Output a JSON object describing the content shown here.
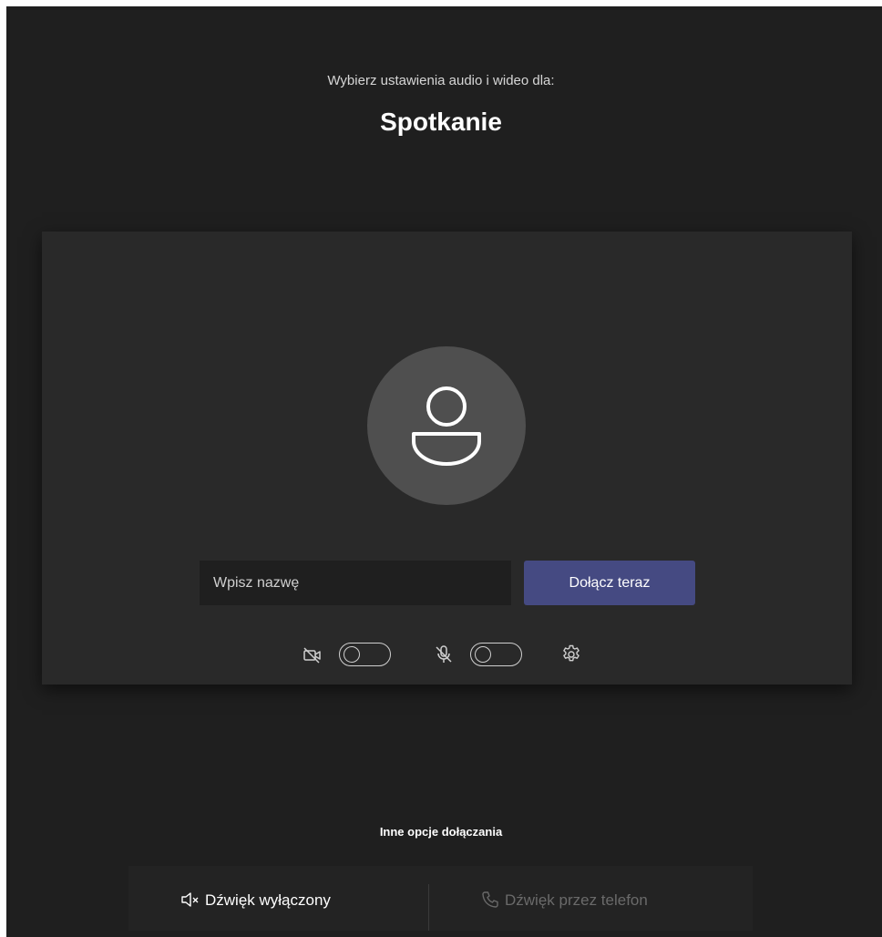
{
  "header": {
    "subtitle": "Wybierz ustawienia audio i wideo dla:",
    "meeting_title": "Spotkanie"
  },
  "prejoin": {
    "avatar_icon": "person-icon",
    "name_placeholder": "Wpisz nazwę",
    "join_label": "Dołącz teraz",
    "join_color": "#454a82",
    "camera": {
      "icon": "camera-off-icon",
      "on": false
    },
    "microphone": {
      "icon": "mic-off-icon",
      "on": false
    },
    "settings_icon": "gear-icon"
  },
  "other_options": {
    "label": "Inne opcje dołączania",
    "audio_off": {
      "label": "Dźwięk wyłączony",
      "icon": "speaker-muted-icon"
    },
    "phone_audio": {
      "label": "Dźwięk przez telefon",
      "icon": "phone-icon",
      "enabled": false
    }
  },
  "colors": {
    "background": "#1f1f1f",
    "panel": "#292929",
    "accent": "#454a82"
  }
}
